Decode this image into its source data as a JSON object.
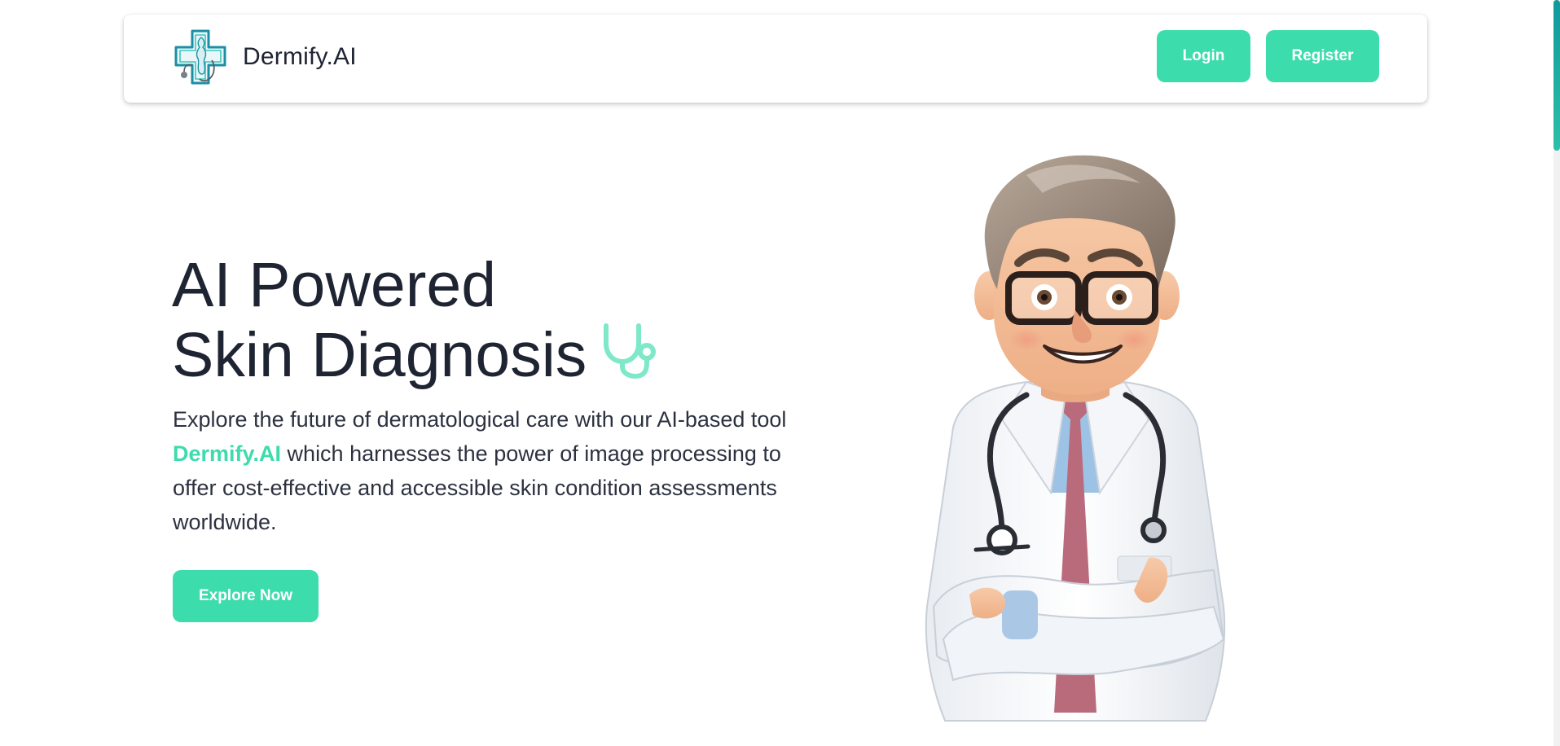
{
  "header": {
    "brand_name": "Dermify.AI",
    "login_label": "Login",
    "register_label": "Register"
  },
  "hero": {
    "title_line1": "AI Powered",
    "title_line2": "Skin Diagnosis",
    "description_before": "Explore the future of dermatological care with our AI-based tool ",
    "description_highlight": "Dermify.AI",
    "description_after": " which harnesses the power of image processing to offer cost-effective and accessible skin condition assessments worldwide.",
    "cta_label": "Explore Now"
  },
  "icons": {
    "logo": "medical-cross-logo-icon",
    "title_icon": "stethoscope-icon"
  },
  "colors": {
    "accent": "#3ddcac",
    "text_dark": "#1f2433",
    "logo_teal": "#1b8fa3"
  }
}
